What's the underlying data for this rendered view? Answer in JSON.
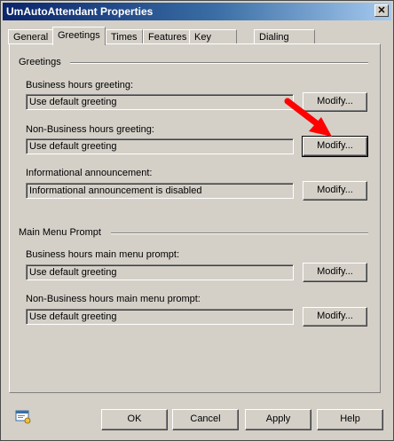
{
  "window": {
    "title": "UmAutoAttendant Properties",
    "close_label": "✕"
  },
  "tabs": [
    {
      "label": "General"
    },
    {
      "label": "Greetings"
    },
    {
      "label": "Times"
    },
    {
      "label": "Features"
    },
    {
      "label": "Key Mapping"
    },
    {
      "label": "Dialing Restrictions"
    }
  ],
  "greetings_section": {
    "title": "Greetings",
    "business_hours": {
      "label": "Business hours greeting:",
      "value": "Use default greeting",
      "button": "Modify..."
    },
    "non_business_hours": {
      "label": "Non-Business hours greeting:",
      "value": "Use default greeting",
      "button": "Modify..."
    },
    "informational": {
      "label": "Informational announcement:",
      "value": "Informational announcement is disabled",
      "button": "Modify..."
    }
  },
  "menu_section": {
    "title": "Main Menu Prompt",
    "business_hours": {
      "label": "Business hours main menu prompt:",
      "value": "Use default greeting",
      "button": "Modify..."
    },
    "non_business_hours": {
      "label": "Non-Business hours main menu prompt:",
      "value": "Use default greeting",
      "button": "Modify..."
    }
  },
  "footer": {
    "ok": "OK",
    "cancel": "Cancel",
    "apply": "Apply",
    "help": "Help"
  },
  "colors": {
    "dialog_bg": "#d4d0c8",
    "title_start": "#0a246a",
    "title_end": "#a6caf0",
    "arrow": "#ff0000"
  }
}
